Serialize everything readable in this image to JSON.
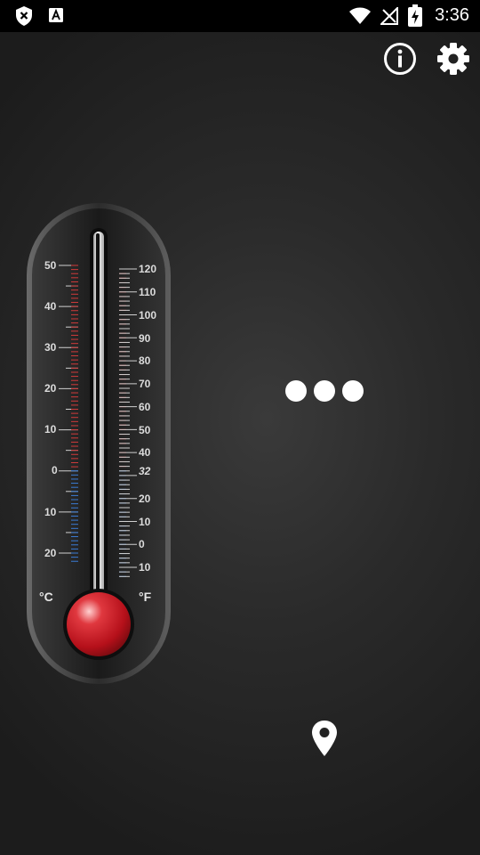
{
  "status_bar": {
    "time": "3:36",
    "icons": [
      "shield-x-icon",
      "font-a-icon",
      "wifi-icon",
      "signal-off-icon",
      "battery-charging-icon"
    ]
  },
  "toolbar": {
    "icons": [
      "info-icon",
      "settings-gear-icon"
    ]
  },
  "thermometer": {
    "celsius_unit": "°C",
    "fahrenheit_unit": "°F",
    "celsius_labels": [
      "50",
      "40",
      "30",
      "20",
      "10",
      "0",
      "10",
      "20"
    ],
    "fahrenheit_labels": [
      "120",
      "110",
      "100",
      "90",
      "80",
      "70",
      "60",
      "50",
      "40",
      "32",
      "20",
      "10",
      "0",
      "10"
    ],
    "colors": {
      "warm_scale": "#d23a3a",
      "cold_scale": "#3a7bd5",
      "bulb": "#c4121a"
    }
  },
  "loading": {
    "icon": "loading-dots-icon"
  },
  "location": {
    "icon": "location-pin-icon"
  }
}
